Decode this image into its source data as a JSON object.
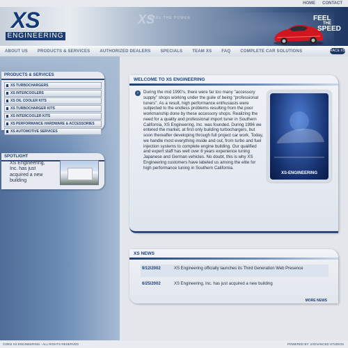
{
  "top_links": [
    "HOME",
    "CONTACT"
  ],
  "header": {
    "logo_main": "XS",
    "logo_sub": "ENGINEERING",
    "ghost_logo": "XS",
    "ghost_tagline": "FEEL THE POWER",
    "tagline_l1": "FEEL",
    "tagline_l2": "THE",
    "tagline_l3": "SPEED"
  },
  "nav": {
    "items": [
      "ABOUT US",
      "PRODUCTS & SERVICES",
      "AUTHORIZED DEALERS",
      "SPECIALS",
      "TEAM XS",
      "FAQ",
      "COMPLETE CAR SOLUTIONS"
    ],
    "right_label": "RACE XS"
  },
  "products": {
    "title": "PRODUCTS & SERVICES",
    "items": [
      "XS TURBOCHARGERS",
      "XS INTERCOOLERS",
      "XS OIL COOLER KITS",
      "XS TURBOCHARGER KITS",
      "XS INTERCOOLER KITS",
      "XS PERFORMANCE HARDWARE & ACCESSORIES",
      "XS AUTOMOTIVE SERVICES"
    ]
  },
  "spotlight": {
    "title": "SPOTLIGHT",
    "text": "XS Engineering, Inc. has just acquired a new building"
  },
  "welcome": {
    "title": "WELCOME TO XS ENGINEERING",
    "body": "During the mid 1990's, there were far too many \"accessory supply\" shops working under the guile of being \"professional tuners\". As a result, high performance enthusiasts were subjected to the endless problems resulting from the poor workmanship done by these accessory shops. Realizing the need for a quality and professional import tuner in Southern California, XS Engineering, Inc. was founded. During 1996 we entered the market, at first only building turbochargers, but soon thereafter developing through full project car work. Today, we handle most everything inside and out, from turbo and fuel injection systems to complete engine building. Our qualified and expert staff has well over 8 years experience tuning Japanese and German vehicles. No doubt, this is why XS Engineering customers have labeled us among the elite for high performance tuning in Southern California.",
    "photo_label": "XS-ENGINEERING"
  },
  "news": {
    "title": "XS NEWS",
    "items": [
      {
        "date": "9/12/2002",
        "headline": "XS Engineering officially launches its Third Generation Web Presence"
      },
      {
        "date": "6/25/2002",
        "headline": "XS Engineering, Inc. has just acquired a new building"
      }
    ],
    "more_label": "MORE NEWS"
  },
  "footer": {
    "left": "©2002 XS ENGINEERING - ALL RIGHTS RESERVED",
    "right": "POWERED BY: 2ADVANCED STUDIOS"
  },
  "colors": {
    "brand_navy": "#1b3e78",
    "car_red": "#d0171f"
  }
}
